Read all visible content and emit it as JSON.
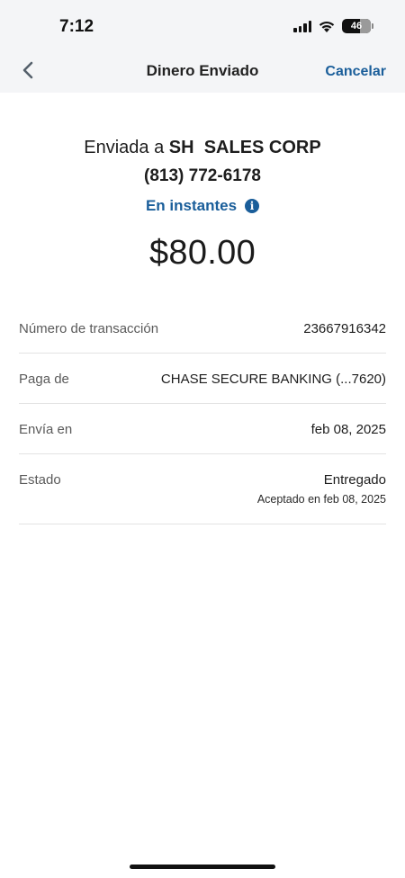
{
  "status_bar": {
    "time": "7:12",
    "battery_level": "46",
    "icons": [
      "signal-icon",
      "wifi-icon",
      "battery-icon"
    ]
  },
  "nav": {
    "title": "Dinero Enviado",
    "cancel_label": "Cancelar",
    "back_icon": "chevron-left-icon"
  },
  "summary": {
    "sent_prefix": "Enviada a",
    "recipient": "SH  SALES CORP",
    "phone": "(813) 772-6178",
    "speed": "En instantes",
    "amount": "$80.00"
  },
  "details": [
    {
      "label": "Número de transacción",
      "value": "23667916342"
    },
    {
      "label": "Paga de",
      "value": "CHASE SECURE BANKING (...7620)"
    },
    {
      "label": "Envía en",
      "value": "feb 08, 2025"
    },
    {
      "label": "Estado",
      "value": "Entregado",
      "sub": "Aceptado en feb 08, 2025"
    }
  ],
  "colors": {
    "accent": "#1a5e9a",
    "header_bg": "#f4f5f7",
    "divider": "#e3e3e3"
  }
}
